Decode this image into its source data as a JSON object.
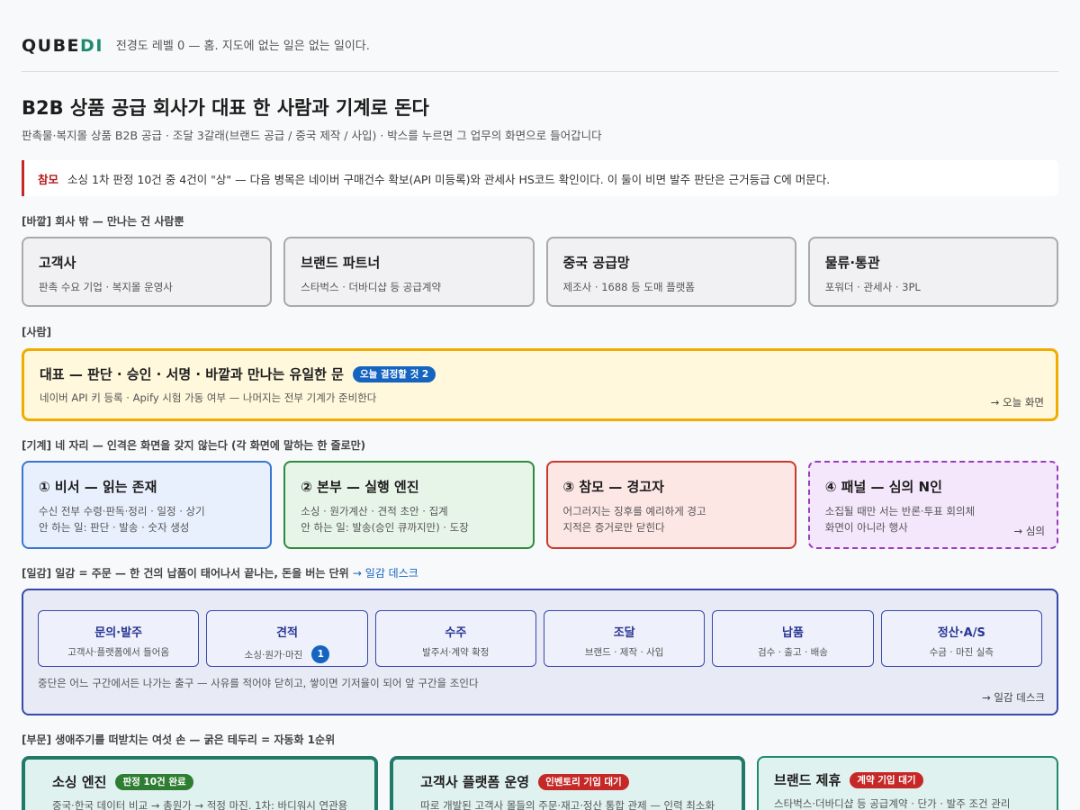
{
  "header": {
    "logo_main": "QUBE",
    "logo_accent": "DI",
    "tagline": "전경도 레벨 0 — 홈. 지도에 없는 일은 없는 일이다."
  },
  "title": "B2B 상품 공급 회사가 대표 한 사람과 기계로 돈다",
  "subtitle": "판촉물·복지몰 상품 B2B 공급 · 조달 3갈래(브랜드 공급 / 중국 제작 / 사입) · 박스를 누르면 그 업무의 화면으로 들어갑니다",
  "alert": {
    "tag": "참모",
    "text": "소싱 1차 판정 10건 중 4건이 \"상\" — 다음 병목은 네이버 구매건수 확보(API 미등록)와 관세사 HS코드 확인이다. 이 둘이 비면 발주 판단은 근거등급 C에 머문다."
  },
  "sections": {
    "outside": "[바깥] 회사 밖 — 만나는 건 사람뿐",
    "people": "[사람]",
    "machines": "[기계] 네 자리 — 인격은 화면을 갖지 않는다 (각 화면에 말하는 한 줄로만)",
    "ilgam": "[일감] 일감 = 주문 — 한 건의 납품이 태어나서 끝나는, 돈을 버는 단위",
    "ilgam_link": "→ 일감 데스크",
    "depts": "[부문] 생애주기를 떠받치는 여섯 손 — 굵은 테두리 = 자동화 1순위"
  },
  "outside": [
    {
      "title": "고객사",
      "desc": "판촉 수요 기업 · 복지몰 운영사"
    },
    {
      "title": "브랜드 파트너",
      "desc": "스타벅스 · 더바디샵 등 공급계약"
    },
    {
      "title": "중국 공급망",
      "desc": "제조사 · 1688 등 도매 플랫폼"
    },
    {
      "title": "물류·통관",
      "desc": "포워더 · 관세사 · 3PL"
    }
  ],
  "ceo": {
    "title": "대표 — 판단 · 승인 · 서명 · 바깥과 만나는 유일한 문",
    "badge": "오늘 결정할 것 2",
    "desc": "네이버 API 키 등록 · Apify 시험 가동 여부 — 나머지는 전부 기계가 준비한다",
    "link": "→ 오늘 화면"
  },
  "machines": [
    {
      "title": "① 비서 — 읽는 존재",
      "line1": "수신 전부 수령·판독·정리 · 일정 · 상기",
      "line2": "안 하는 일: 판단 · 발송 · 숫자 생성"
    },
    {
      "title": "② 본부 — 실행 엔진",
      "line1": "소싱 · 원가계산 · 견적 초안 · 집계",
      "line2": "안 하는 일: 발송(승인 큐까지만) · 도장"
    },
    {
      "title": "③ 참모 — 경고자",
      "line1": "어그러지는 징후를 예리하게 경고",
      "line2": "지적은 증거로만 닫힌다"
    },
    {
      "title": "④ 패널 — 심의 N인",
      "line1": "소집될 때만 서는 반론·투표 회의체",
      "line2": "화면이 아니라 행사",
      "link": "→ 심의"
    }
  ],
  "ilgam": {
    "stages": [
      {
        "name": "문의·발주",
        "desc": "고객사·플랫폼에서 들어옴"
      },
      {
        "name": "견적",
        "desc": "소싱·원가·마진",
        "badge": "1"
      },
      {
        "name": "수주",
        "desc": "발주서·계약 확정"
      },
      {
        "name": "조달",
        "desc": "브랜드 · 제작 · 사입"
      },
      {
        "name": "납품",
        "desc": "검수 · 출고 · 배송"
      },
      {
        "name": "정산·A/S",
        "desc": "수금 · 마진 실측"
      }
    ],
    "note": "중단은 어느 구간에서든 나가는 출구 — 사유를 적어야 닫히고, 쌓이면 기저율이 되어 앞 구간을 조인다",
    "link": "→ 일감 데스크"
  },
  "depts": [
    {
      "title": "소싱 엔진",
      "badge": "판정 10건 완료",
      "badge_color": "#2e7d32",
      "desc": "중국·한국 데이터 비교 → 총원가 → 적정 마진. 1차: 바디워시 연관용"
    },
    {
      "title": "고객사 플랫폼 운영",
      "badge": "인벤토리 기입 대기",
      "badge_color": "#c62828",
      "desc": "따로 개발된 고객사 몰들의 주문·재고·정산 통합 관제 — 인력 최소화"
    },
    {
      "title": "브랜드 제휴",
      "badge": "계약 기입 대기",
      "badge_color": "#c62828",
      "desc": "스타벅스·더바디샵 등 공급계약 · 단가 · 발주 조건 관리"
    }
  ],
  "colors": {
    "accent": "#1f8a70",
    "alert": "#c62828",
    "ceo_border": "#f0ad00",
    "ilgam": "#3949ab"
  }
}
